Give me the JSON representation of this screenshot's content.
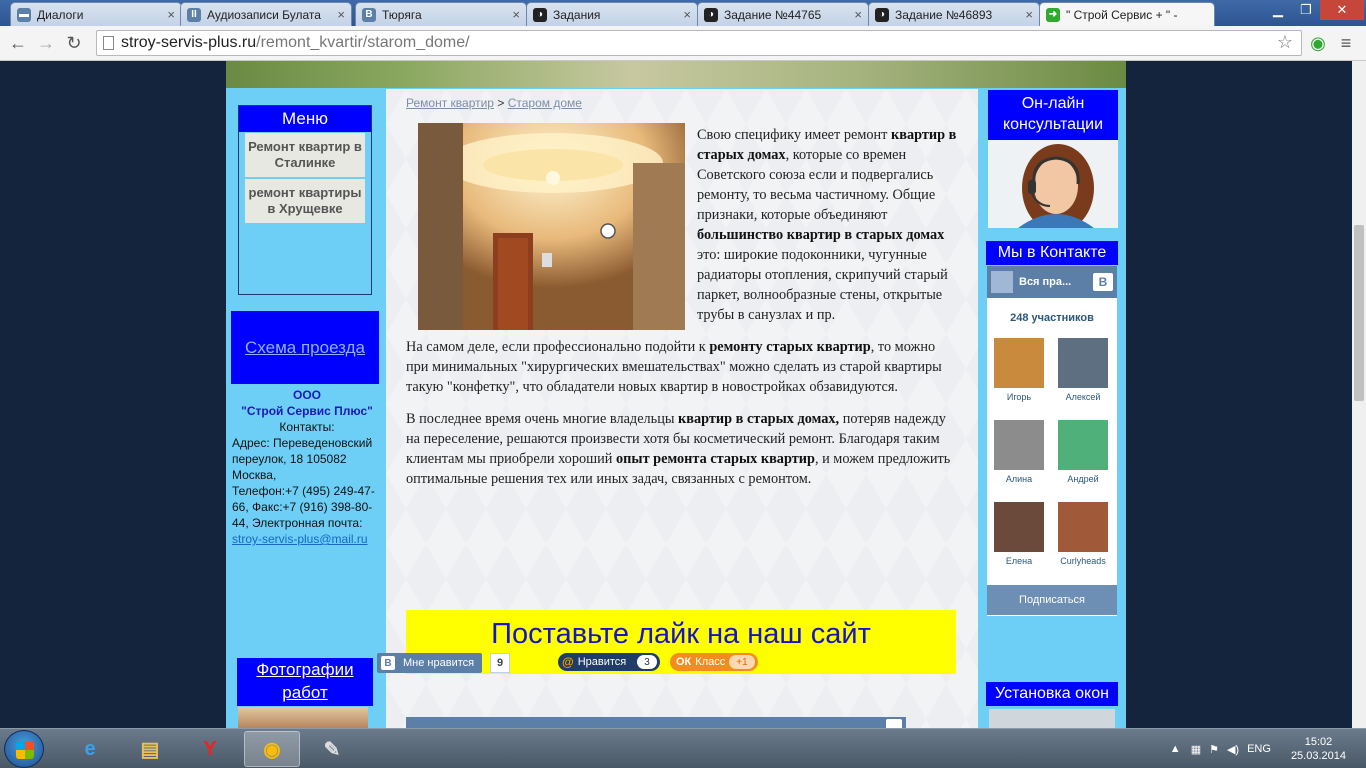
{
  "browser": {
    "tabs": [
      {
        "title": "Диалоги",
        "color": "#5b7fa6",
        "glyph": "▬"
      },
      {
        "title": "Аудиозаписи Булата",
        "color": "#5b7fa6",
        "glyph": "II"
      },
      {
        "title": "Тюряга",
        "color": "#5b7fa6",
        "glyph": "B"
      },
      {
        "title": "Задания",
        "color": "#222222",
        "glyph": "◑"
      },
      {
        "title": "Задание №44765",
        "color": "#222222",
        "glyph": "◑"
      },
      {
        "title": "Задание №46893",
        "color": "#222222",
        "glyph": "◑"
      },
      {
        "title": "\" Строй Сервис + \" - ",
        "color": "#2eaa2e",
        "glyph": "➜"
      }
    ],
    "url_host": "stroy-servis-plus.ru",
    "url_path": "/remont_kvartir/starom_dome/"
  },
  "left": {
    "menu_title": "Меню",
    "menu_items": [
      "Ремонт квартир в Сталинке",
      "ремонт квартиры в Хрущевке"
    ],
    "route_link": "Схема проезда",
    "company_ooo": "ООО",
    "company_name": "\"Строй Сервис Плюс\"",
    "contacts_label": "Контакты:",
    "address": "Адрес: Переведеновский переулок, 18 105082 Москва,",
    "phones": "Телефон:+7 (495) 249-47-66, Факс:+7 (916) 398-80-44, Электронная почта:",
    "email": "stroy-servis-plus@mail.ru",
    "photos_title": "Фотографии работ"
  },
  "content": {
    "breadcrumb_1": "Ремонт квартир",
    "breadcrumb_sep": ">",
    "breadcrumb_2": "Старом доме",
    "p1_a": "Свою специфику имеет ремонт ",
    "p1_b": "квартир в старых домах",
    "p1_c": ", которые со времен Советского союза если и подвергались ремонту, то весьма частичному. Общие признаки, которые объединяют ",
    "p1_d": "большинство квартир в старых домах",
    "p1_e": " это: широкие подоконники, чугунные радиаторы отопления, скрипучий старый паркет, волнообразные стены, открытые трубы в санузлах и пр.",
    "p2_a": "На самом деле, если профессионально подойти к ",
    "p2_b": "ремонту старых квартир",
    "p2_c": ", то можно при минимальных \"хирургических вмешательствах\" можно сделать из старой квартиры такую \"конфетку\", что обладатели новых квартир в новостройках обзавидуются.",
    "p3_a": "В последнее время очень многие владельцы ",
    "p3_b": "квартир в старых домах,",
    "p3_c": " потеряв надежду на переселение, решаются произвести хотя бы косметический ремонт. Благодаря таким клиентам мы приобрели хороший ",
    "p3_d": "опыт ремонта старых квартир",
    "p3_e": ", и можем предложить оптимальные решения тех или иных задач, связанных с ремонтом.",
    "like_banner": "Поставьте лайк на наш сайт",
    "vk_like_label": "Мне нравится",
    "vk_like_b": "B",
    "vk_like_count": "9",
    "mail_like_label": "Нравится",
    "mail_like_count": "3",
    "ok_like_label": "Класс",
    "ok_like_count": "+1"
  },
  "right": {
    "consult_title": "Он-лайн консультации",
    "vk_title": "Мы в Контакте",
    "vk_group": "Вся пра...",
    "vk_b": "B",
    "vk_members_count": "248 участников",
    "members": [
      {
        "name": "Игорь",
        "color": "#c98a3e"
      },
      {
        "name": "Алексей",
        "color": "#5d6f80"
      },
      {
        "name": "Алина",
        "color": "#8c8c8c"
      },
      {
        "name": "Андрей",
        "color": "#4fb07a"
      },
      {
        "name": "Елена",
        "color": "#6b4a3c"
      },
      {
        "name": "Curlyheads",
        "color": "#a05a3a"
      }
    ],
    "subscribe": "Подписаться",
    "install_title": "Установка окон"
  },
  "taskbar": {
    "lang": "ENG",
    "time": "15:02",
    "date": "25.03.2014"
  }
}
